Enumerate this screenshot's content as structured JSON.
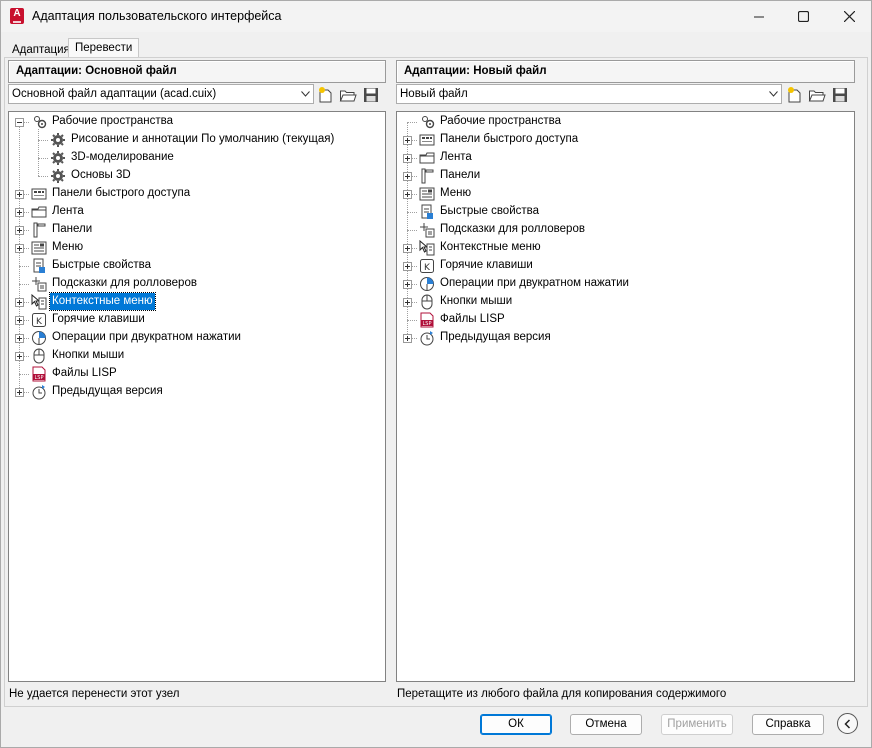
{
  "window": {
    "title": "Адаптация пользовательского интерфейса",
    "app_icon": {
      "letter": "A",
      "color": "#c8102e"
    }
  },
  "tabs": [
    {
      "label": "Адаптация",
      "active": false
    },
    {
      "label": "Перевести",
      "active": true
    }
  ],
  "left_panel": {
    "header": "Адаптации: Основной файл",
    "combo_value": "Основной файл адаптации (acad.cuix)",
    "status": "Не удается перенести этот узел",
    "tree": [
      {
        "label": "Рабочие пространства",
        "icon": "workspaces-icon",
        "expander": "minus",
        "level": 0
      },
      {
        "label": "Рисование и аннотации По умолчанию (текущая)",
        "icon": "gear-icon",
        "level": 1
      },
      {
        "label": "3D-моделирование",
        "icon": "gear-icon",
        "level": 1
      },
      {
        "label": "Основы 3D",
        "icon": "gear-icon",
        "level": 1
      },
      {
        "label": "Панели быстрого доступа",
        "icon": "quick-access-toolbar-icon",
        "expander": "plus",
        "level": 0
      },
      {
        "label": "Лента",
        "icon": "ribbon-icon",
        "expander": "plus",
        "level": 0
      },
      {
        "label": "Панели",
        "icon": "toolbars-icon",
        "expander": "plus",
        "level": 0
      },
      {
        "label": "Меню",
        "icon": "menu-icon",
        "expander": "plus",
        "level": 0
      },
      {
        "label": "Быстрые свойства",
        "icon": "quick-properties-icon",
        "level": 0
      },
      {
        "label": "Подсказки для ролловеров",
        "icon": "rollover-tooltips-icon",
        "level": 0
      },
      {
        "label": "Контекстные меню",
        "icon": "shortcut-menus-icon",
        "expander": "plus",
        "level": 0,
        "selected": true
      },
      {
        "label": "Горячие клавиши",
        "icon": "keyboard-shortcuts-icon",
        "expander": "plus",
        "level": 0
      },
      {
        "label": "Операции при двукратном нажатии",
        "icon": "double-click-icon",
        "expander": "plus",
        "level": 0
      },
      {
        "label": "Кнопки мыши",
        "icon": "mouse-buttons-icon",
        "expander": "plus",
        "level": 0
      },
      {
        "label": "Файлы LISP",
        "icon": "lisp-files-icon",
        "level": 0
      },
      {
        "label": "Предыдущая версия",
        "icon": "legacy-icon",
        "expander": "plus",
        "level": 0
      }
    ]
  },
  "right_panel": {
    "header": "Адаптации: Новый файл",
    "combo_value": "Новый файл",
    "status": "Перетащите из любого файла для копирования содержимого",
    "tree": [
      {
        "label": "Рабочие пространства",
        "icon": "workspaces-icon",
        "level": 0
      },
      {
        "label": "Панели быстрого доступа",
        "icon": "quick-access-toolbar-icon",
        "expander": "plus",
        "level": 0
      },
      {
        "label": "Лента",
        "icon": "ribbon-icon",
        "expander": "plus",
        "level": 0
      },
      {
        "label": "Панели",
        "icon": "toolbars-icon",
        "expander": "plus",
        "level": 0
      },
      {
        "label": "Меню",
        "icon": "menu-icon",
        "expander": "plus",
        "level": 0
      },
      {
        "label": "Быстрые свойства",
        "icon": "quick-properties-icon",
        "level": 0
      },
      {
        "label": "Подсказки для ролловеров",
        "icon": "rollover-tooltips-icon",
        "level": 0
      },
      {
        "label": "Контекстные меню",
        "icon": "shortcut-menus-icon",
        "expander": "plus",
        "level": 0
      },
      {
        "label": "Горячие клавиши",
        "icon": "keyboard-shortcuts-icon",
        "expander": "plus",
        "level": 0
      },
      {
        "label": "Операции при двукратном нажатии",
        "icon": "double-click-icon",
        "expander": "plus",
        "level": 0
      },
      {
        "label": "Кнопки мыши",
        "icon": "mouse-buttons-icon",
        "expander": "plus",
        "level": 0
      },
      {
        "label": "Файлы LISP",
        "icon": "lisp-files-icon",
        "level": 0
      },
      {
        "label": "Предыдущая версия",
        "icon": "legacy-icon",
        "expander": "plus",
        "level": 0
      }
    ]
  },
  "buttons": {
    "ok": "ОК",
    "cancel": "Отмена",
    "apply": "Применить",
    "help": "Справка"
  },
  "colors": {
    "selection": "#0078d7",
    "lisp": "#b0103a"
  }
}
